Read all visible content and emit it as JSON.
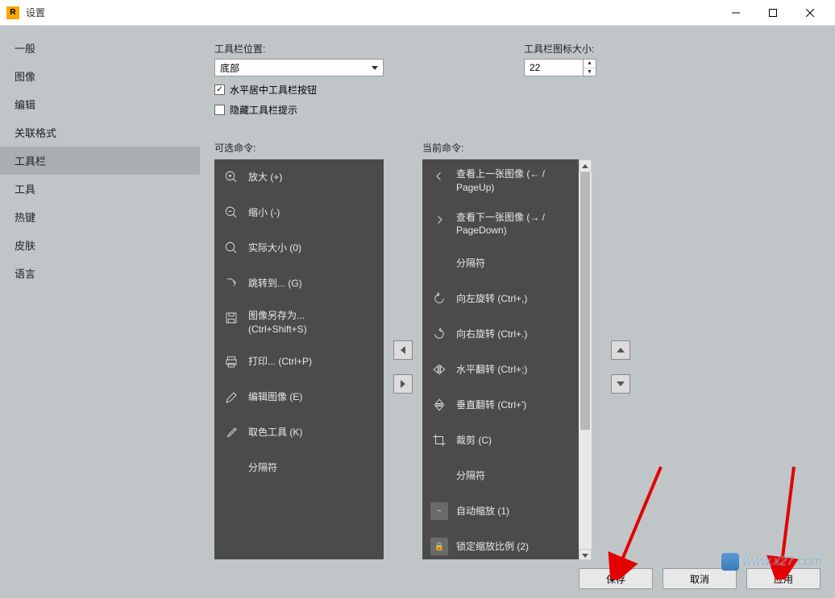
{
  "window": {
    "title": "设置"
  },
  "sidebar": {
    "items": [
      {
        "label": "一般"
      },
      {
        "label": "图像"
      },
      {
        "label": "编辑"
      },
      {
        "label": "关联格式"
      },
      {
        "label": "工具栏"
      },
      {
        "label": "工具"
      },
      {
        "label": "热键"
      },
      {
        "label": "皮肤"
      },
      {
        "label": "语言"
      }
    ],
    "active_index": 4
  },
  "toolbar_position": {
    "label": "工具栏位置:",
    "value": "底部"
  },
  "icon_size": {
    "label": "工具栏图标大小:",
    "value": "22"
  },
  "checks": {
    "center_label": "水平居中工具栏按钮",
    "center_checked": true,
    "hide_tips_label": "隐藏工具栏提示",
    "hide_tips_checked": false
  },
  "available": {
    "header": "可选命令:",
    "items": [
      {
        "label": "放大 (+)",
        "icon": "zoom-in"
      },
      {
        "label": "缩小 (-)",
        "icon": "zoom-out"
      },
      {
        "label": "实际大小 (0)",
        "icon": "actual-size"
      },
      {
        "label": "跳转到... (G)",
        "icon": "goto"
      },
      {
        "label": "图像另存为...\n(Ctrl+Shift+S)",
        "icon": "save-as"
      },
      {
        "label": "打印... (Ctrl+P)",
        "icon": "print"
      },
      {
        "label": "编辑图像 (E)",
        "icon": "edit"
      },
      {
        "label": "取色工具 (K)",
        "icon": "color-picker"
      },
      {
        "label": "分隔符",
        "icon": "none"
      }
    ]
  },
  "current": {
    "header": "当前命令:",
    "items": [
      {
        "label": "查看上一张图像 (← /\nPageUp)",
        "icon": "prev"
      },
      {
        "label": "查看下一张图像 (→ /\nPageDown)",
        "icon": "next"
      },
      {
        "label": "分隔符",
        "icon": "none"
      },
      {
        "label": "向左旋转 (Ctrl+,)",
        "icon": "rotate-left"
      },
      {
        "label": "向右旋转 (Ctrl+.)",
        "icon": "rotate-right"
      },
      {
        "label": "水平翻转 (Ctrl+;)",
        "icon": "flip-h"
      },
      {
        "label": "垂直翻转 (Ctrl+')",
        "icon": "flip-v"
      },
      {
        "label": "裁剪 (C)",
        "icon": "crop"
      },
      {
        "label": "分隔符",
        "icon": "none"
      },
      {
        "label": "自动缩放 (1)",
        "icon": "auto-scale",
        "boxed": true,
        "iconText": "~"
      },
      {
        "label": "锁定缩放比例 (2)",
        "icon": "lock",
        "boxed": true,
        "iconText": "🔒"
      }
    ]
  },
  "footer": {
    "save": "保存",
    "cancel": "取消",
    "apply": "应用"
  },
  "watermark": "www.x27.com"
}
